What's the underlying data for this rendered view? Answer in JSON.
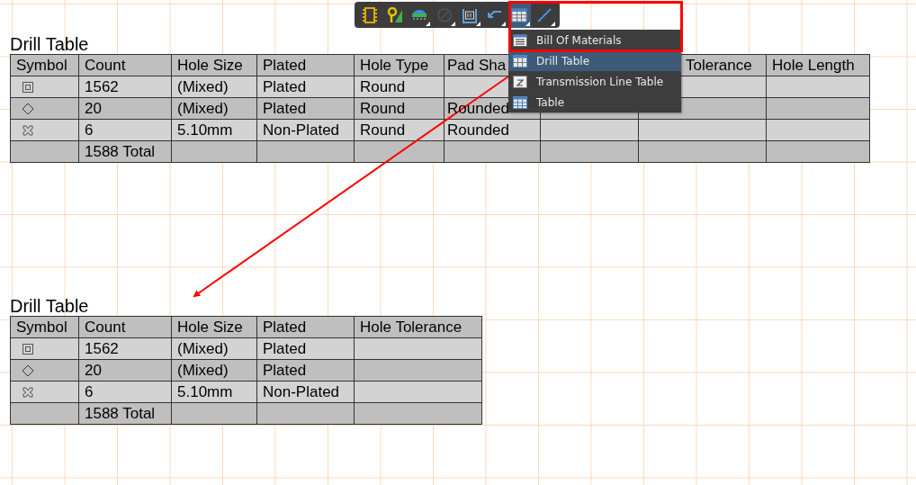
{
  "toolbar": {
    "buttons": [
      {
        "kind": "component",
        "selected": false,
        "disabled": false,
        "dropdown": false
      },
      {
        "kind": "pad",
        "selected": false,
        "disabled": false,
        "dropdown": false
      },
      {
        "kind": "connector",
        "selected": false,
        "disabled": false,
        "dropdown": true
      },
      {
        "kind": "circle",
        "selected": false,
        "disabled": true,
        "dropdown": true
      },
      {
        "kind": "dimension",
        "selected": false,
        "disabled": false,
        "dropdown": true
      },
      {
        "kind": "route",
        "selected": false,
        "disabled": false,
        "dropdown": true
      },
      {
        "kind": "table",
        "selected": true,
        "disabled": false,
        "dropdown": true
      },
      {
        "kind": "line",
        "selected": false,
        "disabled": false,
        "dropdown": true
      }
    ]
  },
  "menu": {
    "items": [
      {
        "kind": "bom",
        "label": "Bill Of Materials",
        "selected": false
      },
      {
        "kind": "drill",
        "label": "Drill Table",
        "selected": true
      },
      {
        "kind": "transmission",
        "label": "Transmission Line Table",
        "selected": false
      },
      {
        "kind": "table",
        "label": "Table",
        "selected": false
      }
    ]
  },
  "tables": [
    {
      "title": "Drill Table",
      "columns": [
        "Symbol",
        "Count",
        "Hole Size",
        "Plated",
        "Hole Type",
        "Pad Sha",
        null,
        "Tolerance",
        "Hole Length"
      ],
      "rows": [
        {
          "kind": "square",
          "cells": [
            "",
            "1562",
            "(Mixed)",
            "Plated",
            "Round",
            "",
            null,
            "",
            ""
          ]
        },
        {
          "kind": "diamond",
          "cells": [
            "",
            "20",
            "(Mixed)",
            "Plated",
            "Round",
            "Rounded",
            "",
            "",
            ""
          ]
        },
        {
          "kind": "cross",
          "cells": [
            "",
            "6",
            "5.10mm",
            "Non-Plated",
            "Round",
            "Rounded",
            "",
            "",
            ""
          ]
        },
        {
          "kind": "none",
          "cells": [
            "",
            "1588 Total",
            "",
            "",
            "",
            "",
            "",
            "",
            ""
          ]
        }
      ]
    },
    {
      "title": "Drill Table",
      "columns": [
        "Symbol",
        "Count",
        "Hole Size",
        "Plated",
        "Hole Tolerance"
      ],
      "rows": [
        {
          "kind": "square",
          "cells": [
            "",
            "1562",
            "(Mixed)",
            "Plated",
            ""
          ]
        },
        {
          "kind": "diamond",
          "cells": [
            "",
            "20",
            "(Mixed)",
            "Plated",
            ""
          ]
        },
        {
          "kind": "cross",
          "cells": [
            "",
            "6",
            "5.10mm",
            "Non-Plated",
            ""
          ]
        },
        {
          "kind": "none",
          "cells": [
            "",
            "1588 Total",
            "",
            "",
            ""
          ]
        }
      ]
    }
  ]
}
